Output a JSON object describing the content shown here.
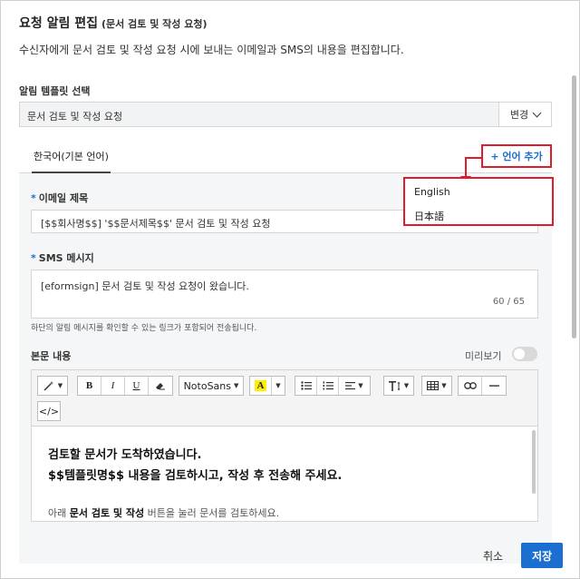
{
  "dialog": {
    "title": "요청 알림 편집",
    "subtitle": "(문서 검토 및 작성 요청)",
    "description": "수신자에게 문서 검토 및 작성 요청 시에 보내는 이메일과 SMS의 내용을 편집합니다."
  },
  "template": {
    "label": "알림 템플릿 선택",
    "value": "문서 검토 및 작성 요청",
    "change_label": "변경"
  },
  "tabs": {
    "active": "한국어(기본 언어)",
    "add_language": "+ 언어 추가"
  },
  "language_menu": {
    "items": [
      "English",
      "日本語"
    ]
  },
  "email": {
    "label": "이메일 제목",
    "value": "[$$회사명$$] '$$문서제목$$' 문서 검토 및 작성 요청"
  },
  "sms": {
    "label": "SMS 메시지",
    "value": "[eformsign] 문서 검토 및 작성 요청이 왔습니다.",
    "counter": "60 / 65",
    "hint": "하단의 알림 메시지를 확인할 수 있는 링크가 포함되어 전송됩니다."
  },
  "body": {
    "label": "본문 내용",
    "preview_label": "미리보기",
    "line1": "검토할 문서가 도착하였습니다.",
    "line2": "$$템플릿명$$ 내용을 검토하시고, 작성 후 전송해 주세요.",
    "line3_pre": "아래 ",
    "line3_bold": "문서 검토 및 작성",
    "line3_post": " 버튼을 눌러 문서를 검토하세요."
  },
  "toolbar": {
    "bold": "B",
    "italic": "I",
    "underline": "U",
    "font": "NotoSans",
    "font_color": "A",
    "code": "</>"
  },
  "footer": {
    "cancel": "취소",
    "save": "저장"
  },
  "colors": {
    "accent": "#1a6fd0",
    "highlight_border": "#e01c2c"
  }
}
